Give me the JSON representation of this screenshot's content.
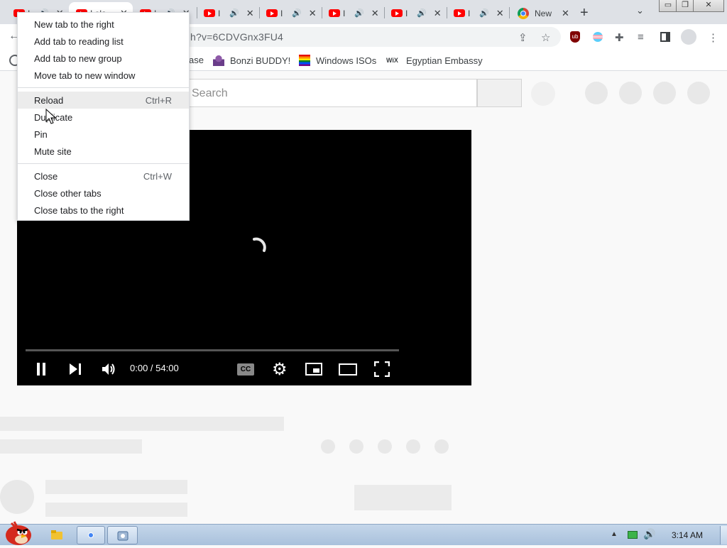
{
  "tabs": [
    {
      "title": "I",
      "icon": "youtube-icon",
      "audio": true,
      "active": false
    },
    {
      "title": "I ola",
      "icon": "youtube-icon",
      "audio": false,
      "active": true
    },
    {
      "title": "I",
      "icon": "youtube-icon",
      "audio": true,
      "active": false
    },
    {
      "title": "I",
      "icon": "youtube-icon",
      "audio": true,
      "active": false
    },
    {
      "title": "I",
      "icon": "youtube-icon",
      "audio": true,
      "active": false
    },
    {
      "title": "I",
      "icon": "youtube-icon",
      "audio": true,
      "active": false
    },
    {
      "title": "I",
      "icon": "youtube-icon",
      "audio": true,
      "active": false
    },
    {
      "title": "I",
      "icon": "youtube-icon",
      "audio": true,
      "active": false
    },
    {
      "title": "New",
      "icon": "chrome-icon",
      "audio": false,
      "active": false
    }
  ],
  "window_controls": {
    "minimize": "▭",
    "restore": "❐",
    "close": "✕"
  },
  "toolbar": {
    "url_visible": "h?v=6CDVGnx3FU4",
    "icons": [
      "back-icon",
      "share-icon",
      "star-icon",
      "ublock-icon",
      "colorful-extension-icon",
      "extensions-icon",
      "media-icon",
      "side-panel-icon",
      "profile-icon",
      "menu-icon"
    ]
  },
  "bookmarks": [
    {
      "label": "ase",
      "icon": "none"
    },
    {
      "label": "Bonzi BUDDY!",
      "icon": "bonzi-icon"
    },
    {
      "label": "Windows ISOs",
      "icon": "rainbow-icon"
    },
    {
      "label": "Egyptian Embassy",
      "icon": "wix-icon"
    }
  ],
  "page": {
    "search_placeholder": "Search",
    "video": {
      "time": "0:00 / 54:00",
      "progress": 0
    }
  },
  "context_menu": {
    "groups": [
      [
        {
          "label": "New tab to the right",
          "shortcut": ""
        },
        {
          "label": "Add tab to reading list",
          "shortcut": ""
        },
        {
          "label": "Add tab to new group",
          "shortcut": ""
        },
        {
          "label": "Move tab to new window",
          "shortcut": ""
        }
      ],
      [
        {
          "label": "Reload",
          "shortcut": "Ctrl+R",
          "hover": true
        },
        {
          "label": "Duplicate",
          "shortcut": ""
        },
        {
          "label": "Pin",
          "shortcut": ""
        },
        {
          "label": "Mute site",
          "shortcut": ""
        }
      ],
      [
        {
          "label": "Close",
          "shortcut": "Ctrl+W"
        },
        {
          "label": "Close other tabs",
          "shortcut": ""
        },
        {
          "label": "Close tabs to the right",
          "shortcut": ""
        }
      ]
    ]
  },
  "taskbar": {
    "start_icon": "angry-bird-icon",
    "apps": [
      "explorer-icon",
      "chrome-icon",
      "generic-app-icon"
    ],
    "clock": "3:14 AM"
  }
}
